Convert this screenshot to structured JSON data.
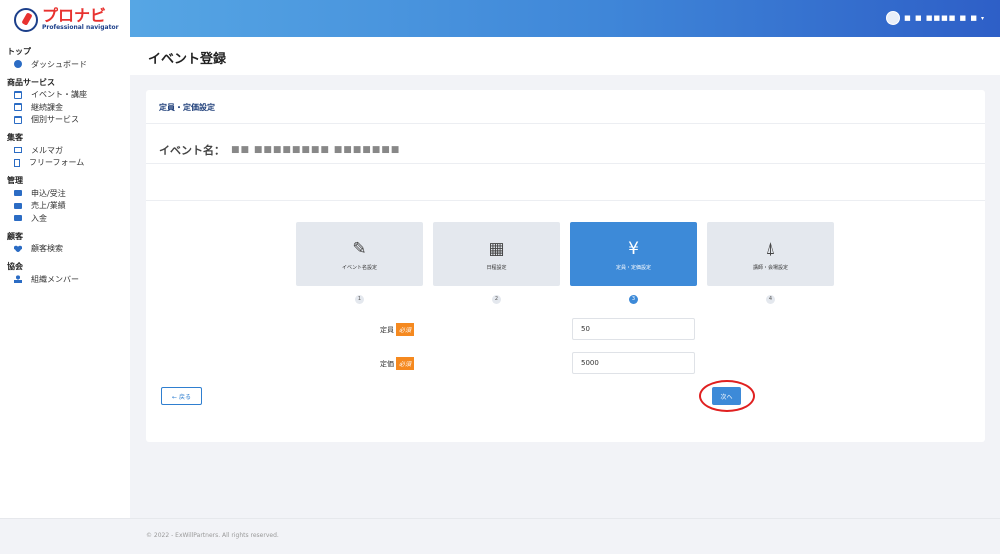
{
  "brand": {
    "title": "プロナビ",
    "subtitle": "Professional navigator"
  },
  "header": {
    "user_name": "■ ■ ■■■■ ■ ■",
    "user_caret": "▾"
  },
  "page": {
    "title": "イベント登録"
  },
  "sidebar": {
    "sections": [
      {
        "heading": "トップ",
        "items": [
          {
            "label": "ダッシュボード",
            "icon": "dashboard-icon"
          }
        ]
      },
      {
        "heading": "商品サービス",
        "items": [
          {
            "label": "イベント・講座",
            "icon": "calendar-icon"
          },
          {
            "label": "継続課金",
            "icon": "calendar-icon"
          },
          {
            "label": "個別サービス",
            "icon": "calendar-icon"
          }
        ]
      },
      {
        "heading": "集客",
        "items": [
          {
            "label": "メルマガ",
            "icon": "mail-icon"
          },
          {
            "label": "フリーフォーム",
            "icon": "document-icon"
          }
        ]
      },
      {
        "heading": "管理",
        "items": [
          {
            "label": "申込/受注",
            "icon": "box-icon"
          },
          {
            "label": "売上/業績",
            "icon": "box-icon"
          },
          {
            "label": "入金",
            "icon": "box-icon"
          }
        ]
      },
      {
        "heading": "顧客",
        "items": [
          {
            "label": "顧客検索",
            "icon": "users-icon"
          }
        ]
      },
      {
        "heading": "協会",
        "items": [
          {
            "label": "組織メンバー",
            "icon": "user-icon"
          }
        ]
      }
    ]
  },
  "card": {
    "section_title": "定員・定価設定",
    "event_label": "イベント名：",
    "event_value": "■■ ■■■■■■■■ ■■■■■■■"
  },
  "steps": [
    {
      "num": "1",
      "label": "イベント名設定",
      "icon": "edit-icon",
      "glyph": "✎",
      "active": false
    },
    {
      "num": "2",
      "label": "日程設定",
      "icon": "calendar-icon",
      "glyph": "▦",
      "active": false
    },
    {
      "num": "3",
      "label": "定員・定価設定",
      "icon": "yen-icon",
      "glyph": "¥",
      "active": true
    },
    {
      "num": "4",
      "label": "講師・会場設定",
      "icon": "location-icon",
      "glyph": "⍋",
      "active": false
    }
  ],
  "form": {
    "capacity": {
      "label": "定員",
      "required": "必須",
      "value": "50"
    },
    "price": {
      "label": "定価",
      "required": "必須",
      "value": "5000"
    }
  },
  "buttons": {
    "back": "← 戻る",
    "next": "次へ"
  },
  "footer": {
    "copyright": "© 2022 - ExWillPartners. All rights reserved."
  },
  "colors": {
    "accent": "#3d8ad8",
    "required": "#f5891f",
    "highlight": "#e02020"
  }
}
